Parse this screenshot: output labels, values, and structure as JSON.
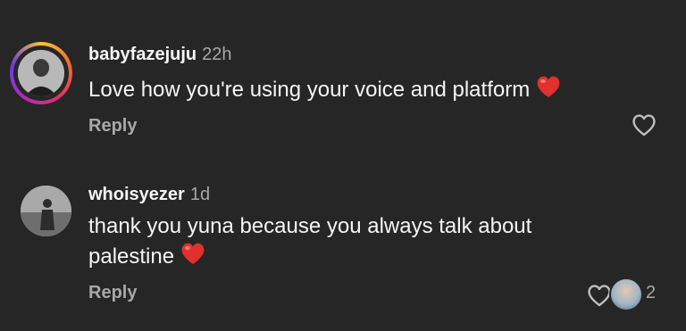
{
  "comments": [
    {
      "username": "babyfazejuju",
      "time": "22h",
      "text": "Love how you're using your voice and platform",
      "emoji": "red-heart",
      "reply_label": "Reply",
      "has_story_ring": true
    },
    {
      "username": "whoisyezer",
      "time": "1d",
      "text_line1": "thank you yuna because you always talk about",
      "text_line2": "palestine",
      "emoji": "red-heart",
      "reply_label": "Reply",
      "like_count": "2"
    }
  ],
  "colors": {
    "background": "#262626",
    "primary_text": "#f5f5f5",
    "secondary_text": "#a8a8a8",
    "heart": "#e0312f"
  },
  "icons": [
    "heart-outline-icon",
    "red-heart-emoji"
  ]
}
